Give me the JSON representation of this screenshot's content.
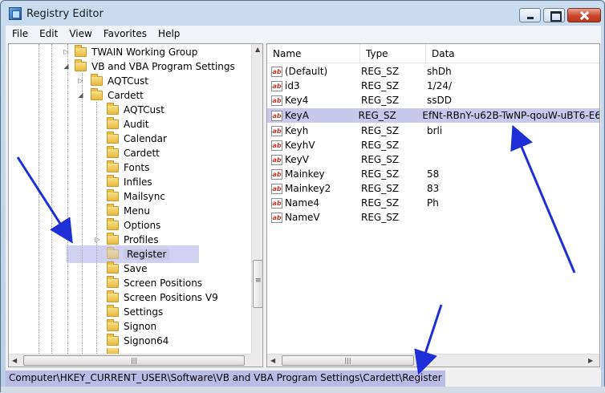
{
  "window": {
    "title": "Registry Editor"
  },
  "menu": [
    "File",
    "Edit",
    "View",
    "Favorites",
    "Help"
  ],
  "tree": [
    {
      "label": "TWAIN Working Group",
      "expander": "▷"
    },
    {
      "label": "VB and VBA Program Settings",
      "expander": "◢"
    },
    {
      "label": "AQTCust",
      "expander": "▷"
    },
    {
      "label": "Cardett",
      "expander": "◢"
    },
    {
      "label": "AQTCust"
    },
    {
      "label": "Audit"
    },
    {
      "label": "Calendar"
    },
    {
      "label": "Cardett"
    },
    {
      "label": "Fonts"
    },
    {
      "label": "Infiles"
    },
    {
      "label": "Mailsync"
    },
    {
      "label": "Menu"
    },
    {
      "label": "Options"
    },
    {
      "label": "Profiles",
      "expander": "▷"
    },
    {
      "label": "Register",
      "selected": true
    },
    {
      "label": "Save"
    },
    {
      "label": "Screen Positions"
    },
    {
      "label": "Screen Positions V9"
    },
    {
      "label": "Settings"
    },
    {
      "label": "Signon"
    },
    {
      "label": "Signon64"
    }
  ],
  "list": {
    "columns": [
      "Name",
      "Type",
      "Data"
    ],
    "rows": [
      {
        "name": "(Default)",
        "type": "REG_SZ",
        "data": "shDh"
      },
      {
        "name": "id3",
        "type": "REG_SZ",
        "data": "1/24/"
      },
      {
        "name": "Key4",
        "type": "REG_SZ",
        "data": "ssDD"
      },
      {
        "name": "KeyA",
        "type": "REG_SZ",
        "data": "EfNt-RBnY-u62B-TwNP-qouW-uBT6-E6",
        "selected": true
      },
      {
        "name": "Keyh",
        "type": "REG_SZ",
        "data": "brli"
      },
      {
        "name": "KeyhV",
        "type": "REG_SZ",
        "data": ""
      },
      {
        "name": "KeyV",
        "type": "REG_SZ",
        "data": ""
      },
      {
        "name": "Mainkey",
        "type": "REG_SZ",
        "data": "58"
      },
      {
        "name": "Mainkey2",
        "type": "REG_SZ",
        "data": "83"
      },
      {
        "name": "Name4",
        "type": "REG_SZ",
        "data": "Ph"
      },
      {
        "name": "NameV",
        "type": "REG_SZ",
        "data": ""
      }
    ]
  },
  "status": {
    "path": "Computer\\HKEY_CURRENT_USER\\Software\\VB and VBA Program Settings\\Cardett\\Register"
  },
  "colors": {
    "selection": "#c8c8e6",
    "annotation_arrow": "#1f2fd6"
  }
}
